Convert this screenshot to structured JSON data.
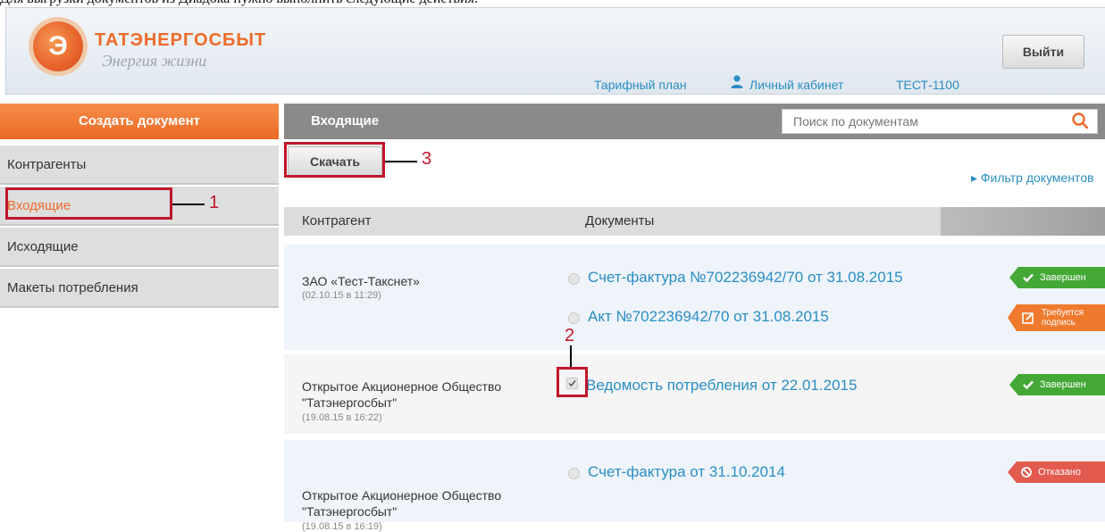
{
  "top_caption": "Для выгрузки документов из Диадока нужно выполнить следующие действия:",
  "header": {
    "brand_name": "ТАТЭНЕРГОСБЫТ",
    "brand_slogan": "Энергия жизни",
    "logo_letter": "Э",
    "nav_tariff": "Тарифный план",
    "nav_cabinet": "Личный кабинет",
    "nav_account": "ТЕСТ-1100",
    "logout_label": "Выйти"
  },
  "sidebar": {
    "create_label": "Создать документ",
    "items": [
      {
        "label": "Контрагенты"
      },
      {
        "label": "Входящие"
      },
      {
        "label": "Исходящие"
      },
      {
        "label": "Макеты потребления"
      }
    ]
  },
  "main": {
    "title": "Входящие",
    "search_placeholder": "Поиск по документам",
    "download_label": "Скачать",
    "filter_label": "▸ Фильтр документов",
    "columns": [
      "Контрагент",
      "Документы"
    ],
    "rows": [
      {
        "company": "ЗАО «Тест-Такснет»",
        "company_line2": "",
        "date": "(02.10.15 в 11:29)",
        "docs": [
          {
            "title": "Счет-фактура №702236942/70 от 31.08.2015",
            "status": "Завершен",
            "checked": false
          },
          {
            "title": "Акт №702236942/70 от 31.08.2015",
            "status": "Требуется подпись",
            "checked": false
          }
        ]
      },
      {
        "company": "Открытое Акционерное Общество",
        "company_line2": "\"Татэнергосбыт\"",
        "date": "(19.08.15 в 16:22)",
        "docs": [
          {
            "title": "Ведомость потребления от 22.01.2015",
            "status": "Завершен",
            "checked": true
          }
        ]
      },
      {
        "company": "Открытое Акционерное Общество",
        "company_line2": "\"Татэнергосбыт\"",
        "date": "(19.08.15 в 16:19)",
        "docs": [
          {
            "title": "Счет-фактура от 31.10.2014",
            "status": "Отказано",
            "checked": false
          }
        ]
      }
    ],
    "badge_lines": {
      "req_1": "Требуется",
      "req_2": "подпись"
    }
  },
  "annotations": [
    "1",
    "2",
    "3"
  ],
  "colors": {
    "accent_orange": "#ee6a2a",
    "link_blue": "#2a8ec4",
    "annotation_red": "#c0162b",
    "status_green": "#43a836",
    "status_orange": "#ef7a2d",
    "status_red": "#e35a4f"
  },
  "icons": [
    "user-icon",
    "search-icon",
    "check-icon",
    "sign-icon",
    "block-icon"
  ]
}
